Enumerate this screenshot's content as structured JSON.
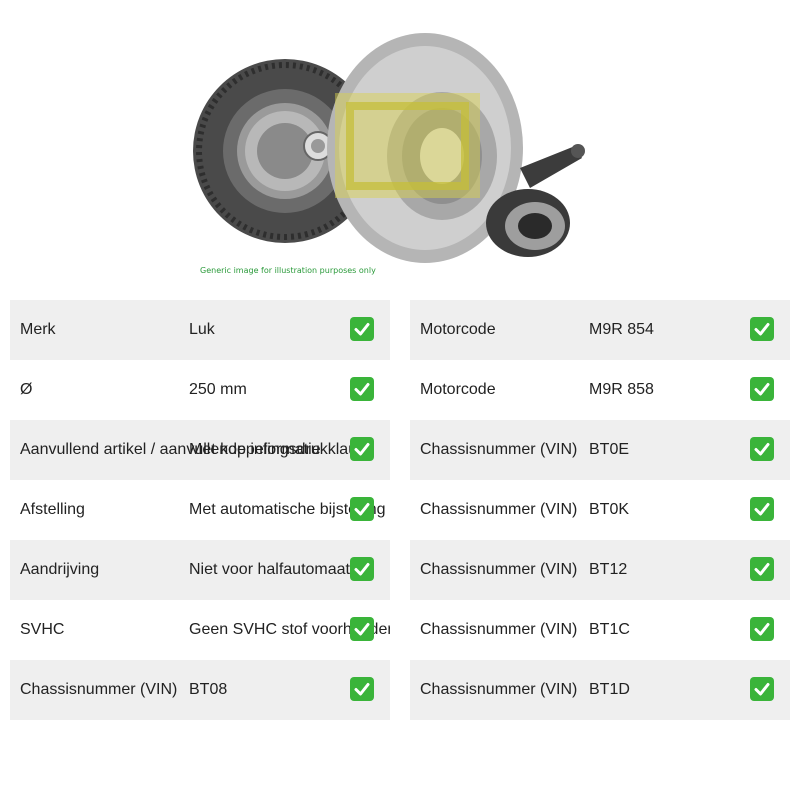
{
  "image": {
    "caption": "Generic image for illustration purposes only",
    "logo_text": "LuK"
  },
  "left_rows": [
    {
      "label": "Merk",
      "value": "Luk"
    },
    {
      "label": "Ø",
      "value": "250 mm"
    },
    {
      "label": "Aanvullend artikel / aanvullende informatie",
      "value": "Met koppelingsdrukklauw"
    },
    {
      "label": "Afstelling",
      "value": "Met automatische bijstelling"
    },
    {
      "label": "Aandrijving",
      "value": "Niet voor halfautomaat"
    },
    {
      "label": "SVHC",
      "value": "Geen SVHC stof voorhanden"
    },
    {
      "label": "Chassisnummer (VIN)",
      "value": "BT08"
    }
  ],
  "right_rows": [
    {
      "label": "Motorcode",
      "value": "M9R 854"
    },
    {
      "label": "Motorcode",
      "value": "M9R 858"
    },
    {
      "label": "Chassisnummer (VIN)",
      "value": "BT0E"
    },
    {
      "label": "Chassisnummer (VIN)",
      "value": "BT0K"
    },
    {
      "label": "Chassisnummer (VIN)",
      "value": "BT12"
    },
    {
      "label": "Chassisnummer (VIN)",
      "value": "BT1C"
    },
    {
      "label": "Chassisnummer (VIN)",
      "value": "BT1D"
    }
  ],
  "check_icon": "check-mark-icon",
  "colors": {
    "shade": "#efefef",
    "check": "#3ab43a",
    "logo": "#d8d24a"
  }
}
